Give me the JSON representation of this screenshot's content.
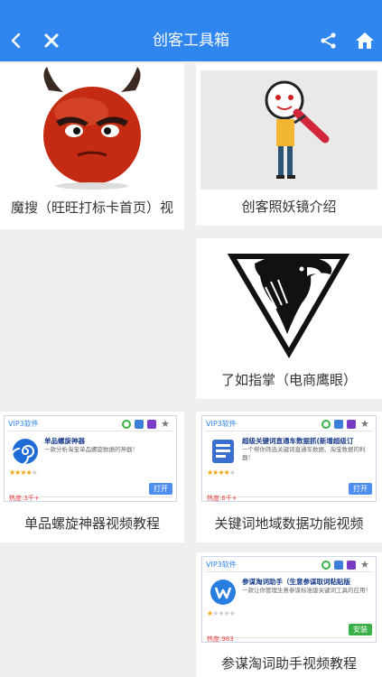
{
  "header": {
    "title": "创客工具箱",
    "bg_color": "#2f86ee",
    "left_icons": [
      "back-icon",
      "close-icon"
    ],
    "right_icons": [
      "share-icon",
      "home-icon"
    ]
  },
  "cards": [
    {
      "label": "魔搜（旺旺打标卡首页）视",
      "thumb": "devil-emoji-image"
    },
    {
      "label": "创客照妖镜介绍",
      "thumb": "magnifier-clown-image"
    },
    {
      "label": "了如指掌（电商鹰眼）",
      "thumb": "eagle-triangle-logo"
    },
    {
      "label": "单品螺旋神器视频教程",
      "thumb": "promo-spiral-tool"
    },
    {
      "label": "关键词地域数据功能视频",
      "thumb": "promo-keyword-tool"
    },
    {
      "label": "参谋淘词助手视频教程",
      "thumb": "promo-word-assistant"
    }
  ],
  "promos": {
    "spiral": {
      "vip": "VIP3软件",
      "title": "单品螺旋神器",
      "desc": "一款分析淘宝单品螺旋数据的神器！",
      "heat": "热度:3千+",
      "button": "打开",
      "rating": 3.5
    },
    "keyword": {
      "vip": "VIP3软件",
      "title": "超级关键词直通车数据抓(新增超级订",
      "desc": "一个帮你筛选关键词直通车数据、淘宝数据的利器！",
      "heat": "热度:6千+",
      "button": "打开",
      "rating": 4
    },
    "assistant": {
      "vip": "VIP3软件",
      "title": "参谋淘词助手（生意参谋取词粘贴版",
      "desc": "一款让你管理生意参谋标准版关键词工具的应用！",
      "heat": "热度:983",
      "button": "安装",
      "rating": 1.5
    }
  }
}
